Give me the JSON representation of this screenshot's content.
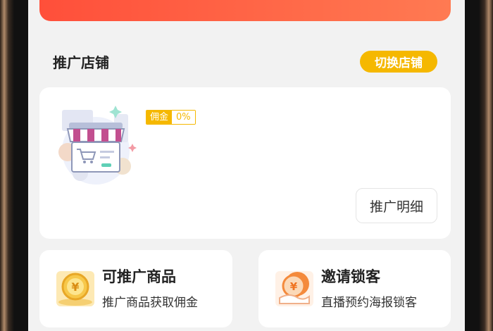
{
  "section": {
    "title": "推广店铺",
    "switch_label": "切换店铺"
  },
  "store_card": {
    "commission_key": "佣金",
    "commission_value": "0%",
    "detail_label": "推广明细"
  },
  "features": [
    {
      "title": "可推广商品",
      "subtitle": "推广商品获取佣金",
      "icon": "coin-icon"
    },
    {
      "title": "邀请锁客",
      "subtitle": "直播预约海报锁客",
      "icon": "coin-hand-icon"
    }
  ],
  "colors": {
    "accent": "#f5b800",
    "banner_start": "#ff4f3a",
    "banner_end": "#ff7a52"
  }
}
